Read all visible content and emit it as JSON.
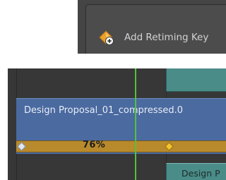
{
  "context_menu": {
    "items": [
      {
        "label": "Add Retiming Key",
        "icon": "add-retiming-key-icon"
      }
    ]
  },
  "timeline": {
    "clip": {
      "name": "Design Proposal_01_compressed.0",
      "color": "#4a6aa0"
    },
    "retime": {
      "speed_label": "76%",
      "bar_color": "#b98a2c",
      "key_color": "#f2c230"
    },
    "adjacent_clip": {
      "name": "Design P",
      "color": "#4a8c88"
    },
    "playhead_color": "#53c23a"
  }
}
